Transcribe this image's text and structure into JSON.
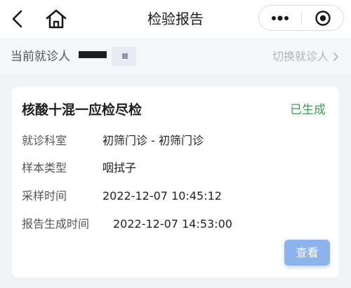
{
  "header": {
    "title": "检验报告",
    "icons": {
      "back": "chevron-left-icon",
      "home": "home-icon",
      "more": "more-dots-icon",
      "close": "target-circle-icon"
    }
  },
  "patient_bar": {
    "label": "当前就诊人",
    "switch_label": "切换就诊人"
  },
  "report_card": {
    "title": "核酸十混一应检尽检",
    "status": "已生成",
    "status_color": "#3f9d57",
    "fields": [
      {
        "label": "就诊科室",
        "value": "初筛门诊 - 初筛门诊"
      },
      {
        "label": "样本类型",
        "value": "咽拭子"
      },
      {
        "label": "采样时间",
        "value": "2022-12-07 10:45:12"
      },
      {
        "label": "报告生成时间",
        "value": "2022-12-07 14:53:00"
      }
    ],
    "view_button_label": "查看",
    "accent_color": "#8cb3ec"
  }
}
